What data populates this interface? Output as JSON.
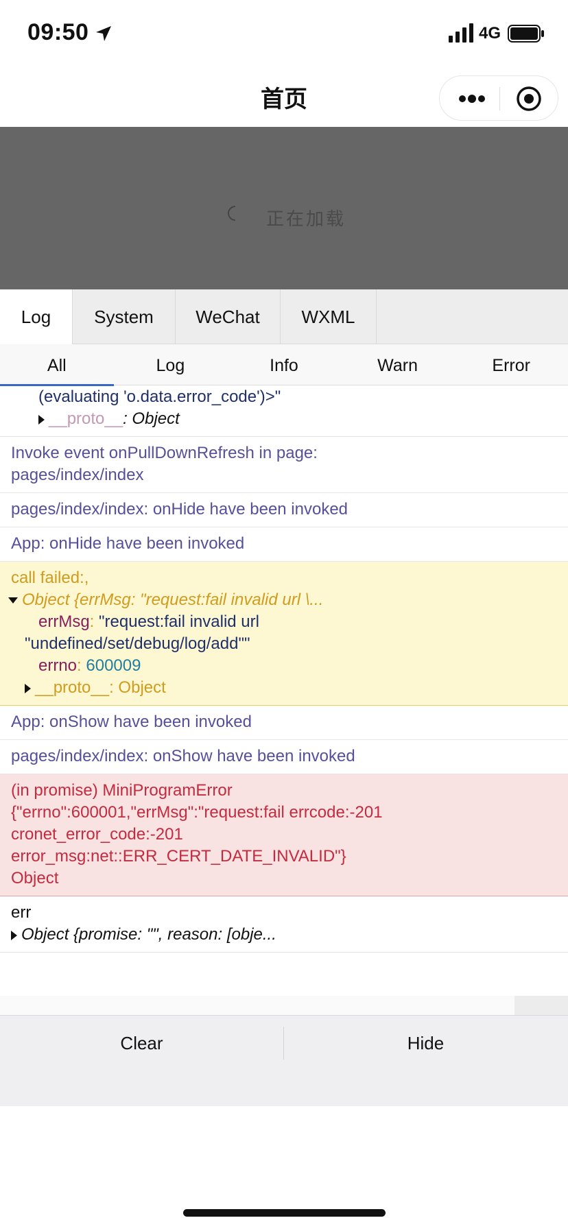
{
  "status_bar": {
    "time": "09:50",
    "network": "4G",
    "icons": [
      "location-arrow-icon",
      "signal-icon",
      "battery-icon"
    ]
  },
  "nav": {
    "title": "首页",
    "icons": [
      "menu-dots-icon",
      "close-circle-icon"
    ]
  },
  "loading": {
    "text": "正在加载"
  },
  "main_tabs": [
    {
      "label": "Log",
      "active": true
    },
    {
      "label": "System",
      "active": false
    },
    {
      "label": "WeChat",
      "active": false
    },
    {
      "label": "WXML",
      "active": false
    }
  ],
  "sub_tabs": [
    {
      "label": "All",
      "active": true
    },
    {
      "label": "Log",
      "active": false
    },
    {
      "label": "Info",
      "active": false
    },
    {
      "label": "Warn",
      "active": false
    },
    {
      "label": "Error",
      "active": false
    }
  ],
  "logs": {
    "entry0": {
      "line1": "(evaluating 'o.data.error_code')>\"",
      "proto_key": "__proto__",
      "proto_value": ": Object"
    },
    "entry1": {
      "line1": "Invoke event onPullDownRefresh in page:",
      "line2": "pages/index/index"
    },
    "entry2": {
      "text": "pages/index/index: onHide have been invoked"
    },
    "entry3": {
      "text": "App: onHide have been invoked"
    },
    "entry4": {
      "line1": "call failed:,",
      "summary": "Object {errMsg: \"request:fail invalid url \\...",
      "errmsg_key": "errMsg",
      "errmsg_value_1": "\"request:fail invalid url",
      "errmsg_value_2": "\"undefined/set/debug/log/add\"\"",
      "errno_key": "errno",
      "errno_value": "600009",
      "proto_key": "__proto__",
      "proto_value": ": Object"
    },
    "entry5": {
      "text": "App: onShow have been invoked"
    },
    "entry6": {
      "text": "pages/index/index: onShow have been invoked"
    },
    "entry7": {
      "line1": "(in promise) MiniProgramError",
      "line2": "{\"errno\":600001,\"errMsg\":\"request:fail errcode:-201",
      "line3": "cronet_error_code:-201",
      "line4": "error_msg:net::ERR_CERT_DATE_INVALID\"}",
      "line5": "Object"
    },
    "entry8": {
      "line1": "err",
      "summary": "Object {promise: \"\", reason: [obje..."
    }
  },
  "toolbar": {
    "clear_label": "Clear",
    "hide_label": "Hide"
  },
  "colors": {
    "log_text": "#56509a",
    "warn_bg": "#fdf8d2",
    "warn_text": "#d09c1f",
    "error_bg": "#f9e2e2",
    "error_text": "#c42b3f",
    "active_tab_underline": "#3a66c4",
    "loading_bg": "#666666"
  }
}
